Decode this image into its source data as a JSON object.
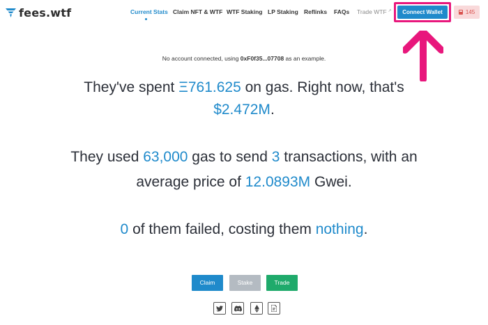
{
  "brand": {
    "name": "fees.wtf"
  },
  "nav": {
    "items": [
      {
        "label": "Current Stats"
      },
      {
        "label": "Claim NFT & WTF"
      },
      {
        "label": "WTF Staking"
      },
      {
        "label": "LP Staking"
      },
      {
        "label": "Reflinks"
      },
      {
        "label": "FAQs"
      },
      {
        "label": "Trade WTF"
      }
    ],
    "connect_label": "Connect Wallet",
    "gas_price": "145"
  },
  "notice": {
    "prefix": "No account connected, using ",
    "address": "0xF0f35...07708",
    "suffix": " as an example."
  },
  "stats": {
    "s1_a": "They've spent ",
    "s1_eth": "Ξ761.625",
    "s1_b": " on gas. Right now, that's",
    "s1_usd": "$2.472M",
    "s1_c": ".",
    "s2_a": "They used ",
    "s2_gas": "63,000",
    "s2_b": " gas to send ",
    "s2_tx": "3",
    "s2_c": " transactions, with an",
    "s2_d": "average price of ",
    "s2_price": "12.0893M",
    "s2_e": " Gwei.",
    "s3_failed": "0",
    "s3_a": " of them failed, costing them ",
    "s3_cost": "nothing",
    "s3_b": "."
  },
  "actions": {
    "claim": "Claim",
    "stake": "Stake",
    "trade": "Trade"
  },
  "colors": {
    "accent": "#1f8acb",
    "highlight": "#e8177c",
    "trade": "#1faa6b",
    "stake": "#b4bbc2",
    "gas_bg": "#f9d9da"
  }
}
